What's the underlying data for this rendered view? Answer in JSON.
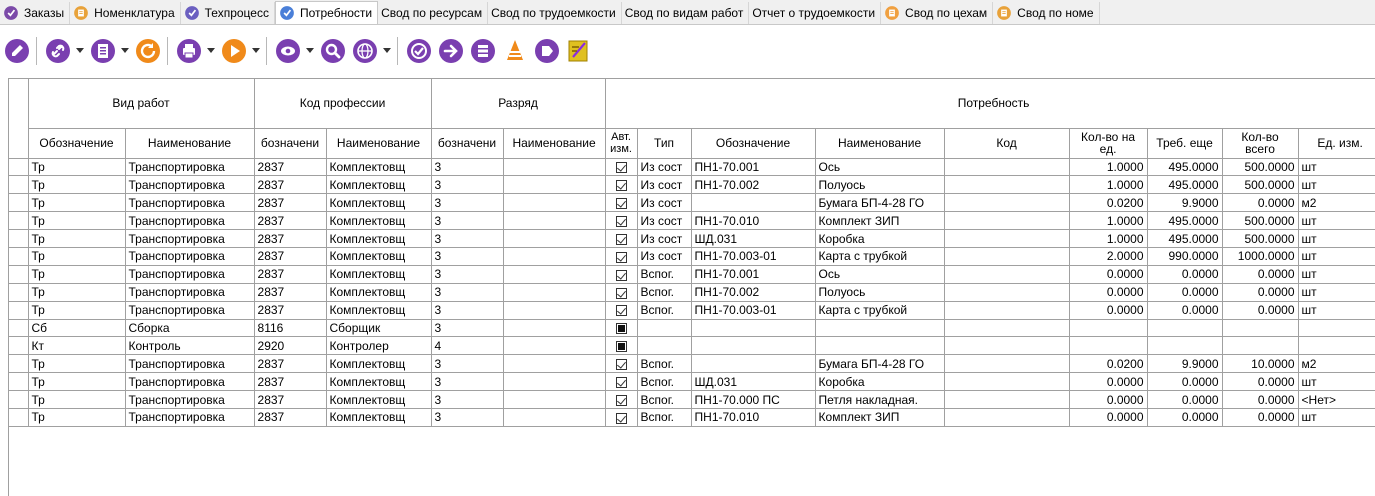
{
  "tabs": [
    {
      "label": "Заказы",
      "icon": "orders-icon",
      "color": "#7b4aa8",
      "active": false
    },
    {
      "label": "Номенклатура",
      "icon": "nomenclature-icon",
      "color": "#e8a23a",
      "active": false
    },
    {
      "label": "Техпроцесс",
      "icon": "techprocess-icon",
      "color": "#6b5fc0",
      "active": false
    },
    {
      "label": "Потребности",
      "icon": "needs-icon",
      "color": "#4a7fd8",
      "active": true
    },
    {
      "label": "Свод по ресурсам",
      "icon": "",
      "color": "",
      "active": false
    },
    {
      "label": "Свод по трудоемкости",
      "icon": "",
      "color": "",
      "active": false
    },
    {
      "label": "Свод по видам работ",
      "icon": "",
      "color": "",
      "active": false
    },
    {
      "label": "Отчет о трудоемкости",
      "icon": "",
      "color": "",
      "active": false
    },
    {
      "label": "Свод по цехам",
      "icon": "workshop-icon",
      "color": "#f0a040",
      "active": false
    },
    {
      "label": "Свод по номе",
      "icon": "nomenclature-summary-icon",
      "color": "#e8a23a",
      "active": false
    }
  ],
  "toolbar": {
    "buttons": [
      {
        "name": "edit-button",
        "icon": "pencil-icon",
        "color": "#7a3fb0",
        "dropdown": false
      },
      {
        "name": "link-button",
        "icon": "link-icon",
        "color": "#7a3fb0",
        "dropdown": true
      },
      {
        "name": "document-button",
        "icon": "document-icon",
        "color": "#7a3fb0",
        "dropdown": true
      },
      {
        "name": "refresh-button",
        "icon": "refresh-icon",
        "color": "#f08a1a",
        "dropdown": false
      },
      {
        "name": "print-button",
        "icon": "printer-icon",
        "color": "#7a3fb0",
        "dropdown": true
      },
      {
        "name": "run-button",
        "icon": "play-icon",
        "color": "#f08a1a",
        "dropdown": true
      },
      {
        "name": "view-button",
        "icon": "eye-icon",
        "color": "#7a3fb0",
        "dropdown": true
      },
      {
        "name": "search-button",
        "icon": "magnifier-icon",
        "color": "#7a3fb0",
        "dropdown": false
      },
      {
        "name": "web-button",
        "icon": "globe-icon",
        "color": "#7a3fb0",
        "dropdown": true
      },
      {
        "name": "resources-button",
        "icon": "resources-icon",
        "color": "#7a3fb0",
        "dropdown": false
      },
      {
        "name": "export-button",
        "icon": "export-icon",
        "color": "#7a3fb0",
        "dropdown": false
      },
      {
        "name": "calculate-button",
        "icon": "calculator-icon",
        "color": "#7a3fb0",
        "dropdown": false
      },
      {
        "name": "stack-button",
        "icon": "stack-icon",
        "color": "#f08a1a",
        "dropdown": false
      },
      {
        "name": "tag-button",
        "icon": "tag-icon",
        "color": "#7a3fb0",
        "dropdown": false
      },
      {
        "name": "edit-note-button",
        "icon": "edit-note-icon",
        "color": "#e0c020",
        "dropdown": false
      }
    ]
  },
  "grid": {
    "group_headers": {
      "work_type": "Вид работ",
      "profession": "Код профессии",
      "grade": "Разряд",
      "need": "Потребность"
    },
    "columns": {
      "wt_code": "Обозначение",
      "wt_name": "Наименование",
      "prof_code": "бозначени",
      "prof_name": "Наименование",
      "grade_code": "бозначени",
      "grade_name": "Наименование",
      "auto": "Авт. изм.",
      "type": "Тип",
      "des": "Обозначение",
      "name": "Наименование",
      "code": "Код",
      "per_unit": "Кол-во на ед.",
      "need_more": "Треб. еще",
      "total": "Кол-во всего",
      "unit": "Ед. изм."
    },
    "rows": [
      {
        "wt_code": "Тр",
        "wt_name": "Транспортировка",
        "prof_code": "2837",
        "prof_name": "Комплектовщ",
        "grade_code": "3",
        "grade_name": "",
        "auto": "checked",
        "type": "Из сост",
        "des": "ПН1-70.001",
        "name": "Ось",
        "code": "",
        "per_unit": "1.0000",
        "need_more": "495.0000",
        "total": "500.0000",
        "unit": "шт"
      },
      {
        "wt_code": "Тр",
        "wt_name": "Транспортировка",
        "prof_code": "2837",
        "prof_name": "Комплектовщ",
        "grade_code": "3",
        "grade_name": "",
        "auto": "checked",
        "type": "Из сост",
        "des": "ПН1-70.002",
        "name": "Полуось",
        "code": "",
        "per_unit": "1.0000",
        "need_more": "495.0000",
        "total": "500.0000",
        "unit": "шт"
      },
      {
        "wt_code": "Тр",
        "wt_name": "Транспортировка",
        "prof_code": "2837",
        "prof_name": "Комплектовщ",
        "grade_code": "3",
        "grade_name": "",
        "auto": "checked",
        "type": "Из сост",
        "des": "",
        "name": "Бумага БП-4-28 ГО",
        "code": "",
        "per_unit": "0.0200",
        "need_more": "9.9000",
        "total": "0.0000",
        "unit": "м2"
      },
      {
        "wt_code": "Тр",
        "wt_name": "Транспортировка",
        "prof_code": "2837",
        "prof_name": "Комплектовщ",
        "grade_code": "3",
        "grade_name": "",
        "auto": "checked",
        "type": "Из сост",
        "des": "ПН1-70.010",
        "name": "Комплект ЗИП",
        "code": "",
        "per_unit": "1.0000",
        "need_more": "495.0000",
        "total": "500.0000",
        "unit": "шт"
      },
      {
        "wt_code": "Тр",
        "wt_name": "Транспортировка",
        "prof_code": "2837",
        "prof_name": "Комплектовщ",
        "grade_code": "3",
        "grade_name": "",
        "auto": "checked",
        "type": "Из сост",
        "des": "ШД.031",
        "name": "Коробка",
        "code": "",
        "per_unit": "1.0000",
        "need_more": "495.0000",
        "total": "500.0000",
        "unit": "шт"
      },
      {
        "wt_code": "Тр",
        "wt_name": "Транспортировка",
        "prof_code": "2837",
        "prof_name": "Комплектовщ",
        "grade_code": "3",
        "grade_name": "",
        "auto": "checked",
        "type": "Из сост",
        "des": "ПН1-70.003-01",
        "name": "Карта с трубкой",
        "code": "",
        "per_unit": "2.0000",
        "need_more": "990.0000",
        "total": "1000.0000",
        "unit": "шт"
      },
      {
        "wt_code": "Тр",
        "wt_name": "Транспортировка",
        "prof_code": "2837",
        "prof_name": "Комплектовщ",
        "grade_code": "3",
        "grade_name": "",
        "auto": "checked",
        "type": "Вспог.",
        "des": "ПН1-70.001",
        "name": "Ось",
        "code": "",
        "per_unit": "0.0000",
        "need_more": "0.0000",
        "total": "0.0000",
        "unit": "шт"
      },
      {
        "wt_code": "Тр",
        "wt_name": "Транспортировка",
        "prof_code": "2837",
        "prof_name": "Комплектовщ",
        "grade_code": "3",
        "grade_name": "",
        "auto": "checked",
        "type": "Вспог.",
        "des": "ПН1-70.002",
        "name": "Полуось",
        "code": "",
        "per_unit": "0.0000",
        "need_more": "0.0000",
        "total": "0.0000",
        "unit": "шт"
      },
      {
        "wt_code": "Тр",
        "wt_name": "Транспортировка",
        "prof_code": "2837",
        "prof_name": "Комплектовщ",
        "grade_code": "3",
        "grade_name": "",
        "auto": "checked",
        "type": "Вспог.",
        "des": "ПН1-70.003-01",
        "name": "Карта с трубкой",
        "code": "",
        "per_unit": "0.0000",
        "need_more": "0.0000",
        "total": "0.0000",
        "unit": "шт"
      },
      {
        "wt_code": "Сб",
        "wt_name": "Сборка",
        "prof_code": "8116",
        "prof_name": "Сборщик",
        "grade_code": "3",
        "grade_name": "",
        "auto": "indeterminate",
        "type": "",
        "des": "",
        "name": "",
        "code": "",
        "per_unit": "",
        "need_more": "",
        "total": "",
        "unit": ""
      },
      {
        "wt_code": "Кт",
        "wt_name": "Контроль",
        "prof_code": "2920",
        "prof_name": "Контролер",
        "grade_code": "4",
        "grade_name": "",
        "auto": "indeterminate",
        "type": "",
        "des": "",
        "name": "",
        "code": "",
        "per_unit": "",
        "need_more": "",
        "total": "",
        "unit": ""
      },
      {
        "wt_code": "Тр",
        "wt_name": "Транспортировка",
        "prof_code": "2837",
        "prof_name": "Комплектовщ",
        "grade_code": "3",
        "grade_name": "",
        "auto": "checked",
        "type": "Вспог.",
        "des": "",
        "name": "Бумага БП-4-28 ГО",
        "code": "",
        "per_unit": "0.0200",
        "need_more": "9.9000",
        "total": "10.0000",
        "unit": "м2"
      },
      {
        "wt_code": "Тр",
        "wt_name": "Транспортировка",
        "prof_code": "2837",
        "prof_name": "Комплектовщ",
        "grade_code": "3",
        "grade_name": "",
        "auto": "checked",
        "type": "Вспог.",
        "des": "ШД.031",
        "name": "Коробка",
        "code": "",
        "per_unit": "0.0000",
        "need_more": "0.0000",
        "total": "0.0000",
        "unit": "шт"
      },
      {
        "wt_code": "Тр",
        "wt_name": "Транспортировка",
        "prof_code": "2837",
        "prof_name": "Комплектовщ",
        "grade_code": "3",
        "grade_name": "",
        "auto": "checked",
        "type": "Вспог.",
        "des": "ПН1-70.000 ПС",
        "name": "Петля накладная.",
        "code": "",
        "per_unit": "0.0000",
        "need_more": "0.0000",
        "total": "0.0000",
        "unit": "<Нет>"
      },
      {
        "wt_code": "Тр",
        "wt_name": "Транспортировка",
        "prof_code": "2837",
        "prof_name": "Комплектовщ",
        "grade_code": "3",
        "grade_name": "",
        "auto": "checked",
        "type": "Вспог.",
        "des": "ПН1-70.010",
        "name": "Комплект ЗИП",
        "code": "",
        "per_unit": "0.0000",
        "need_more": "0.0000",
        "total": "0.0000",
        "unit": "шт"
      }
    ]
  }
}
